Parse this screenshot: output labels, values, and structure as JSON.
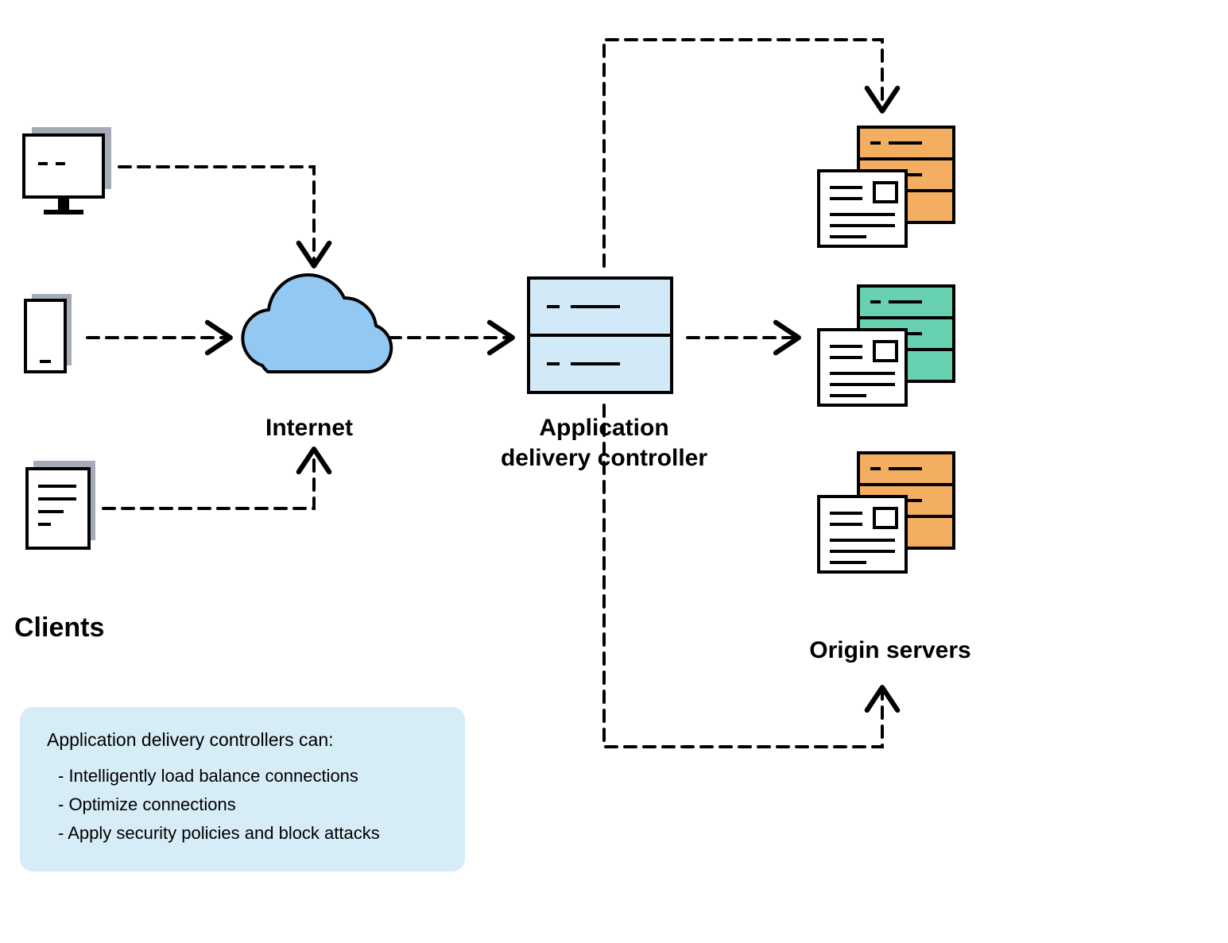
{
  "labels": {
    "clients": "Clients",
    "internet": "Internet",
    "adc": "Application delivery controller",
    "origin": "Origin servers"
  },
  "callout": {
    "title": "Application delivery controllers can:",
    "items": [
      "- Intelligently load balance connections",
      "- Optimize connections",
      "- Apply security policies and block attacks"
    ]
  },
  "nodes": {
    "clients": [
      "desktop-monitor",
      "mobile-phone",
      "document"
    ],
    "internet": "cloud",
    "adc": "server-rack",
    "origin_servers": [
      "server-stack-orange",
      "server-stack-teal",
      "server-stack-orange"
    ]
  },
  "colors": {
    "client_fill": "#a5acb8",
    "cloud_fill": "#92c8f2",
    "adc_fill": "#d2e9f8",
    "server_orange": "#f3ae62",
    "server_teal": "#67d1b2",
    "server_white": "#ffffff",
    "callout_bg": "#d6ecf7",
    "stroke": "#000000"
  },
  "flows": [
    {
      "from": "desktop-client",
      "to": "internet",
      "style": "dashed"
    },
    {
      "from": "mobile-client",
      "to": "internet",
      "style": "dashed"
    },
    {
      "from": "document-client",
      "to": "internet",
      "style": "dashed"
    },
    {
      "from": "internet",
      "to": "adc",
      "style": "dashed"
    },
    {
      "from": "adc",
      "to": "origin-server-1",
      "style": "dashed"
    },
    {
      "from": "adc",
      "to": "origin-server-2",
      "style": "dashed"
    },
    {
      "from": "adc",
      "to": "origin-server-3",
      "style": "dashed"
    }
  ]
}
